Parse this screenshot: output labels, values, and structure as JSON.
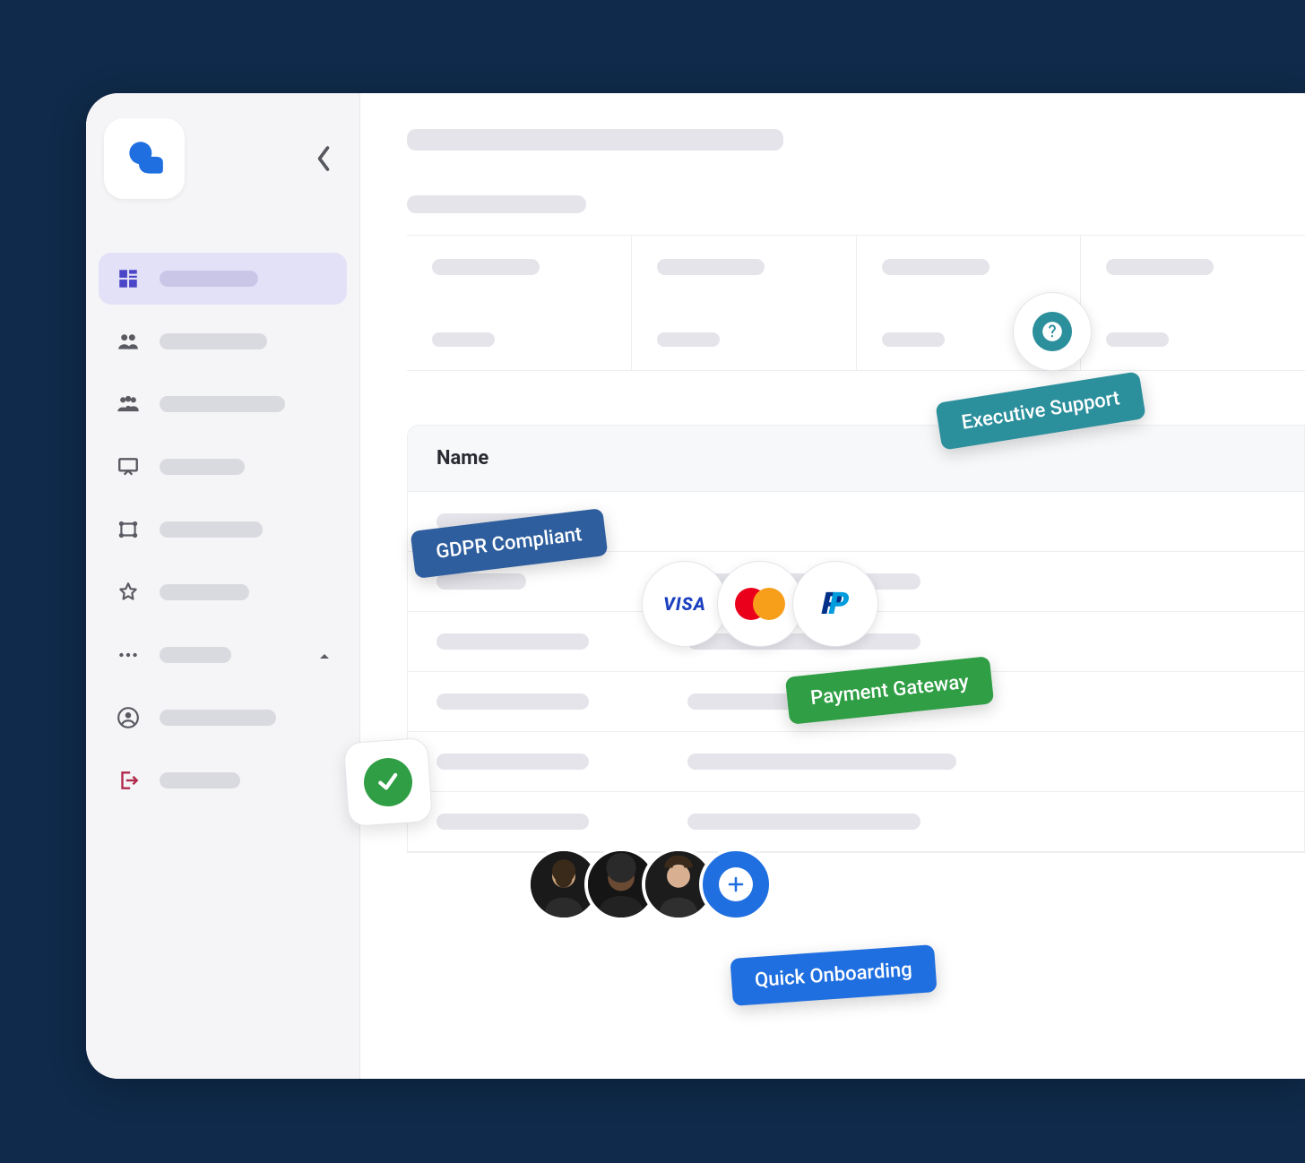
{
  "sidebar": {
    "items": [
      {
        "icon": "dashboard",
        "active": true
      },
      {
        "icon": "people"
      },
      {
        "icon": "group"
      },
      {
        "icon": "presentation"
      },
      {
        "icon": "network"
      },
      {
        "icon": "star"
      },
      {
        "icon": "more",
        "expandable": true
      },
      {
        "icon": "account"
      },
      {
        "icon": "logout"
      }
    ]
  },
  "table": {
    "column_label": "Name"
  },
  "badges": {
    "gdpr": "GDPR Compliant",
    "executive_support": "Executive Support",
    "payment_gateway": "Payment Gateway",
    "quick_onboarding": "Quick Onboarding"
  },
  "payment_methods": [
    "visa",
    "mastercard",
    "paypal"
  ],
  "avatars_count": 3,
  "colors": {
    "bg_navy": "#0f2a4a",
    "accent_blue": "#1f6fe0",
    "green": "#2f9e44",
    "teal": "#2b8f9c",
    "blue_dark": "#2e5e9e",
    "sidebar_active": "#e3e1f7"
  }
}
